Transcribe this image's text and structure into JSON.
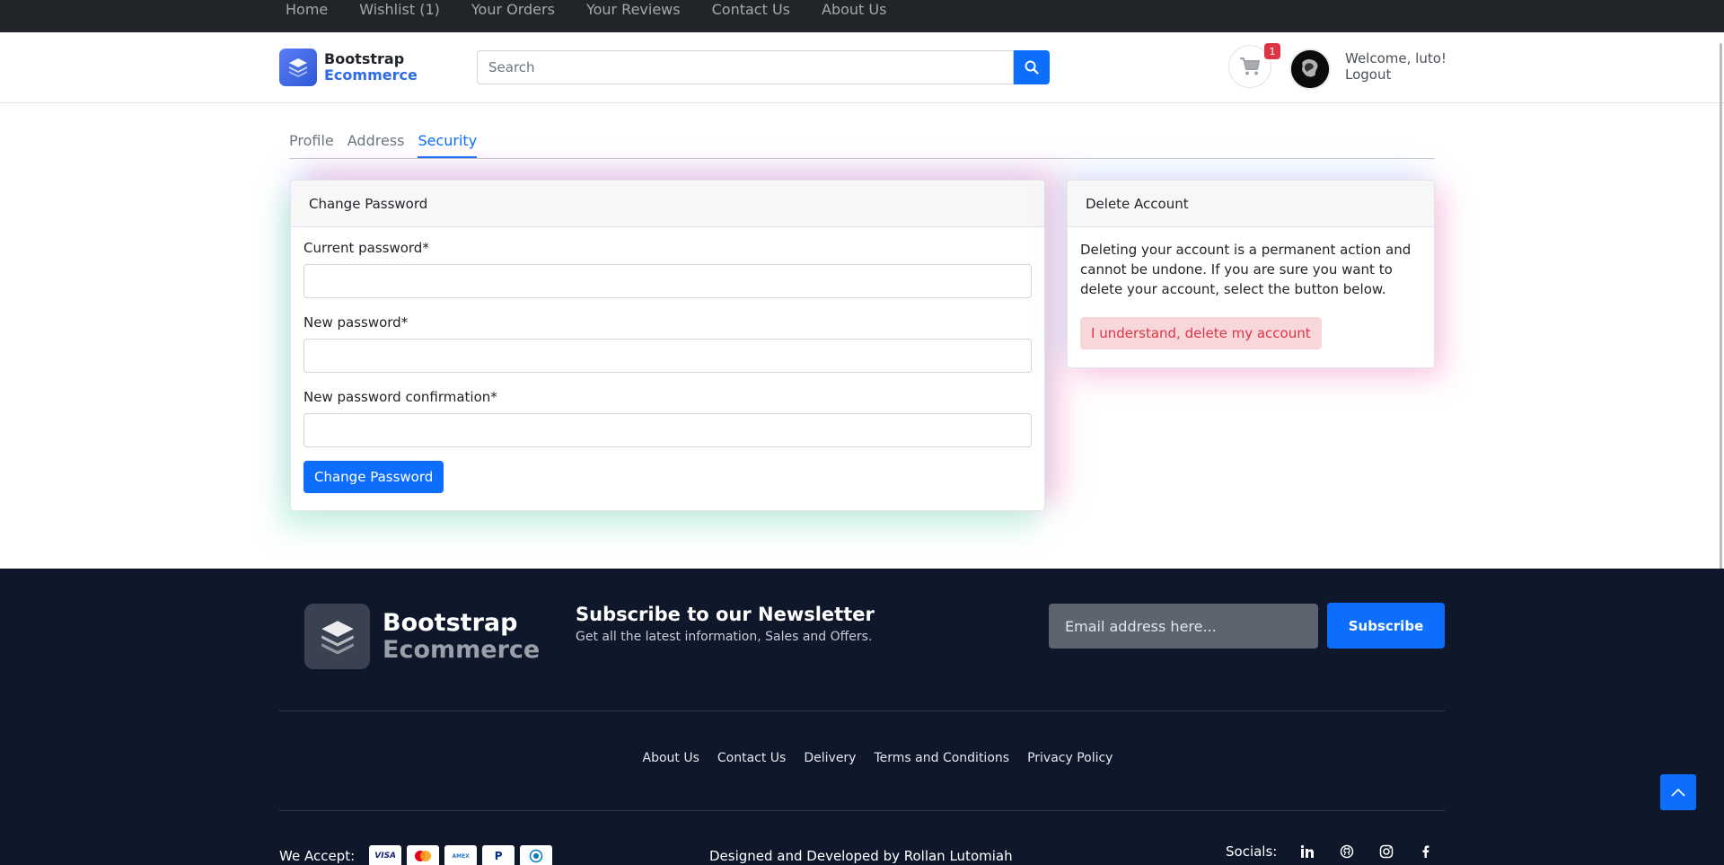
{
  "topnav": {
    "items": [
      "Home",
      "Wishlist (1)",
      "Your Orders",
      "Your Reviews",
      "Contact Us",
      "About Us"
    ]
  },
  "header": {
    "logo_line1": "Bootstrap",
    "logo_line2": "Ecommerce",
    "search_placeholder": "Search",
    "cart_count": "1",
    "welcome": "Welcome, luto!",
    "logout": "Logout"
  },
  "tabs": {
    "items": [
      "Profile",
      "Address",
      "Security"
    ],
    "active": "Security"
  },
  "change_password": {
    "title": "Change Password",
    "current_label": "Current password*",
    "new_label": "New password*",
    "confirm_label": "New password confirmation*",
    "button": "Change Password"
  },
  "delete_account": {
    "title": "Delete Account",
    "text": "Deleting your account is a permanent action and cannot be undone. If you are sure you want to delete your account, select the button below.",
    "button": "I understand, delete my account"
  },
  "footer": {
    "logo_line1": "Bootstrap",
    "logo_line2": "Ecommerce",
    "newsletter_title": "Subscribe to our Newsletter",
    "newsletter_sub": "Get all the latest information, Sales and Offers.",
    "email_placeholder": "Email address here...",
    "subscribe": "Subscribe",
    "links": [
      "About Us",
      "Contact Us",
      "Delivery",
      "Terms and Conditions",
      "Privacy Policy"
    ],
    "we_accept": "We Accept:",
    "payment_methods": [
      "VISA",
      "mastercard",
      "amex",
      "paypal",
      "diners"
    ],
    "designed_by": "Designed and Developed by  Rollan Lutomiah",
    "socials_label": "Socials:",
    "social_icons": [
      "linkedin-icon",
      "github-icon",
      "instagram-icon",
      "facebook-icon"
    ]
  },
  "colors": {
    "primary": "#0d6efd",
    "danger": "#dc3545",
    "footer_bg": "#0f172a",
    "topnav_bg": "#212529"
  }
}
